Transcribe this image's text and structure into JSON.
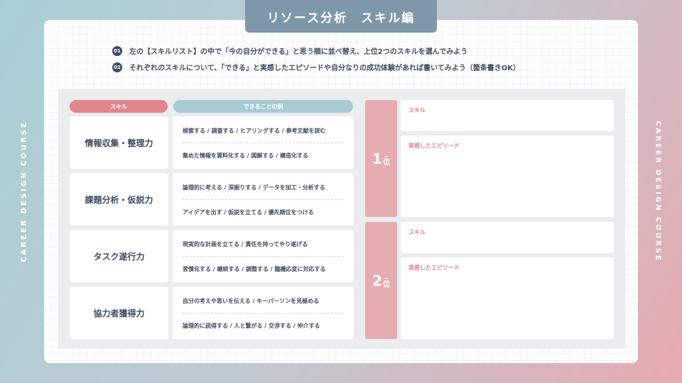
{
  "title": "リソース分析　スキル編",
  "side_left": "CAREER DESIGN COURSE",
  "side_right": "CAREER DESIGN COURSE",
  "instructions": [
    {
      "num": "01",
      "text": "左の【スキルリスト】の中で「今の自分ができる」と思う順に並べ替え、上位2つのスキルを選んでみよう"
    },
    {
      "num": "02",
      "text": "それぞれのスキルについて、「できる」と実感したエピソードや自分なりの成功体験があれば書いてみよう（箇条書きOK）"
    }
  ],
  "headers": {
    "skill": "スキル",
    "can_do": "できることの例"
  },
  "skills": [
    {
      "name": "情報収集・整理力",
      "ex1": "検索する / 調査する / ヒアリングする / 参考文献を読む",
      "ex2": "集めた情報を資料化する / 図解する / 構造化する"
    },
    {
      "name": "課題分析・仮説力",
      "ex1": "論理的に考える / 深掘りする / データを加工・分析する",
      "ex2": "アイデアを出す / 仮説を立てる / 優先順位をつける"
    },
    {
      "name": "タスク遂行力",
      "ex1": "現実的な計画を立てる / 責任を持ってやり遂げる",
      "ex2": "習慣化する / 継続する / 調整する / 臨機応変に対応する"
    },
    {
      "name": "協力者獲得力",
      "ex1": "自分の考えや思いを伝える / キーパーソンを見極める",
      "ex2": "論理的に説得する / 人と繋がる / 交渉する / 仲介する"
    }
  ],
  "ranks": [
    {
      "num": "1",
      "dash": "ー",
      "suffix": "位",
      "skill_label": "スキル",
      "episode_label": "実感したエピソード"
    },
    {
      "num": "2",
      "dash": "ー",
      "suffix": "位",
      "skill_label": "スキル",
      "episode_label": "実感したエピソード"
    }
  ],
  "colors": {
    "accent_pink": "#e2848b",
    "accent_teal": "#a8cbd2",
    "title_bg": "#7f98a9",
    "rank_bg": "#e5adb2",
    "text_dark": "#3f4d63"
  }
}
